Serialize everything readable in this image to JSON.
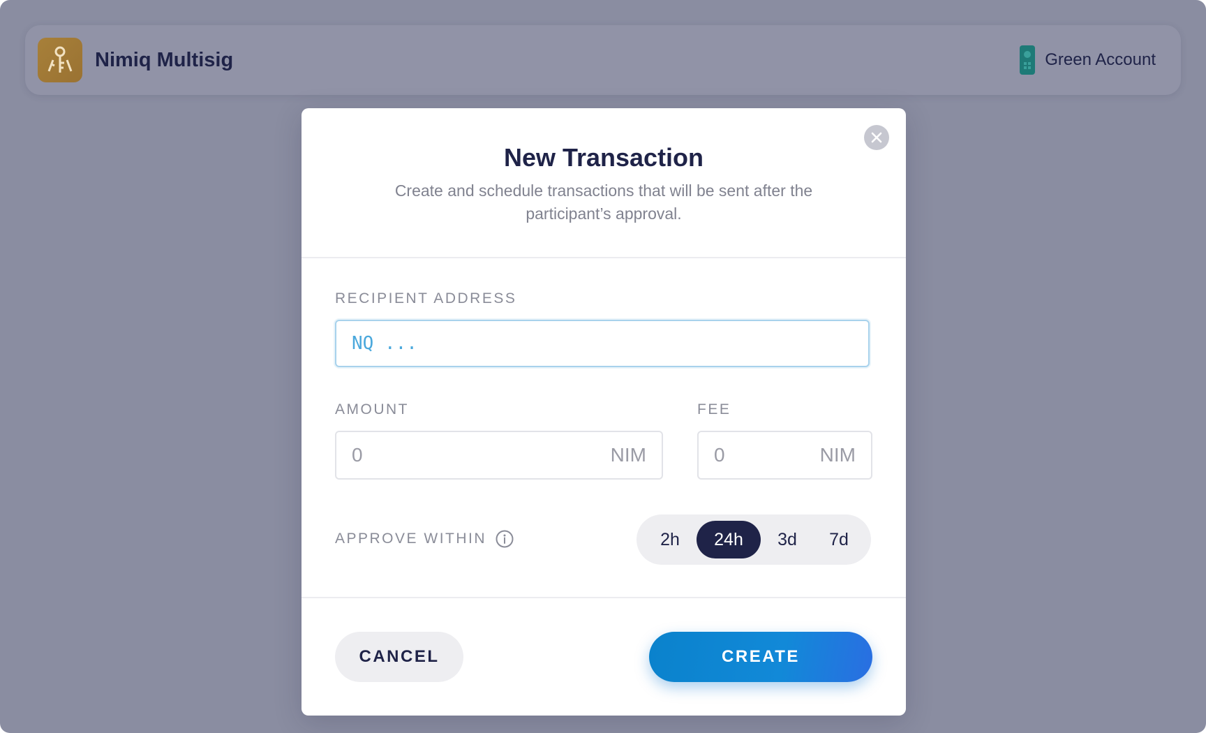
{
  "app": {
    "title": "Nimiq Multisig",
    "account_name": "Green Account"
  },
  "modal": {
    "title": "New Transaction",
    "subtitle": "Create and schedule transactions that will be sent after the participant’s approval.",
    "recipient": {
      "label": "RECIPIENT ADDRESS",
      "placeholder": "NQ ...",
      "value": ""
    },
    "amount": {
      "label": "AMOUNT",
      "value": "0",
      "unit": "NIM"
    },
    "fee": {
      "label": "FEE",
      "value": "0",
      "unit": "NIM"
    },
    "approve_within": {
      "label": "APPROVE WITHIN",
      "options": [
        "2h",
        "24h",
        "3d",
        "7d"
      ],
      "selected": "24h"
    },
    "buttons": {
      "cancel": "CANCEL",
      "create": "CREATE"
    }
  },
  "colors": {
    "backdrop": "#8a8da1",
    "navy": "#1f2348",
    "create_gradient_start": "#0a82cc",
    "create_gradient_end": "#2a6ee2",
    "logo_gold": "#a7803a",
    "account_teal": "#1e7a77"
  },
  "icons": {
    "logo": "keys-logo-icon",
    "account": "account-card-icon",
    "close": "close-icon",
    "info": "info-icon"
  }
}
